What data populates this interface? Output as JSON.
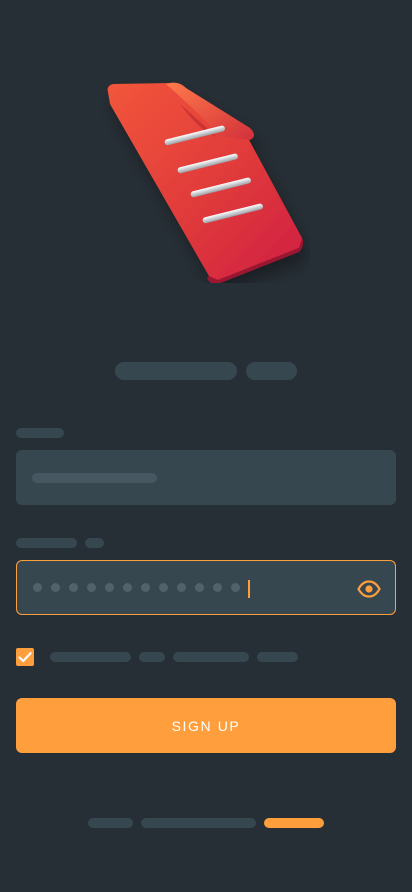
{
  "theme": {
    "background": "#272f36",
    "placeholder": "#37474f",
    "accent": "#ff9e3d",
    "illustration": "#e63838"
  },
  "illustration": {
    "icon": "document-icon"
  },
  "form": {
    "password": {
      "masked_length": 12,
      "focused": true,
      "visibility_icon": "eye-icon"
    },
    "terms_checked": true,
    "submit_label": "SIGN UP"
  },
  "pagination": {
    "pages": 3,
    "current": 3
  }
}
